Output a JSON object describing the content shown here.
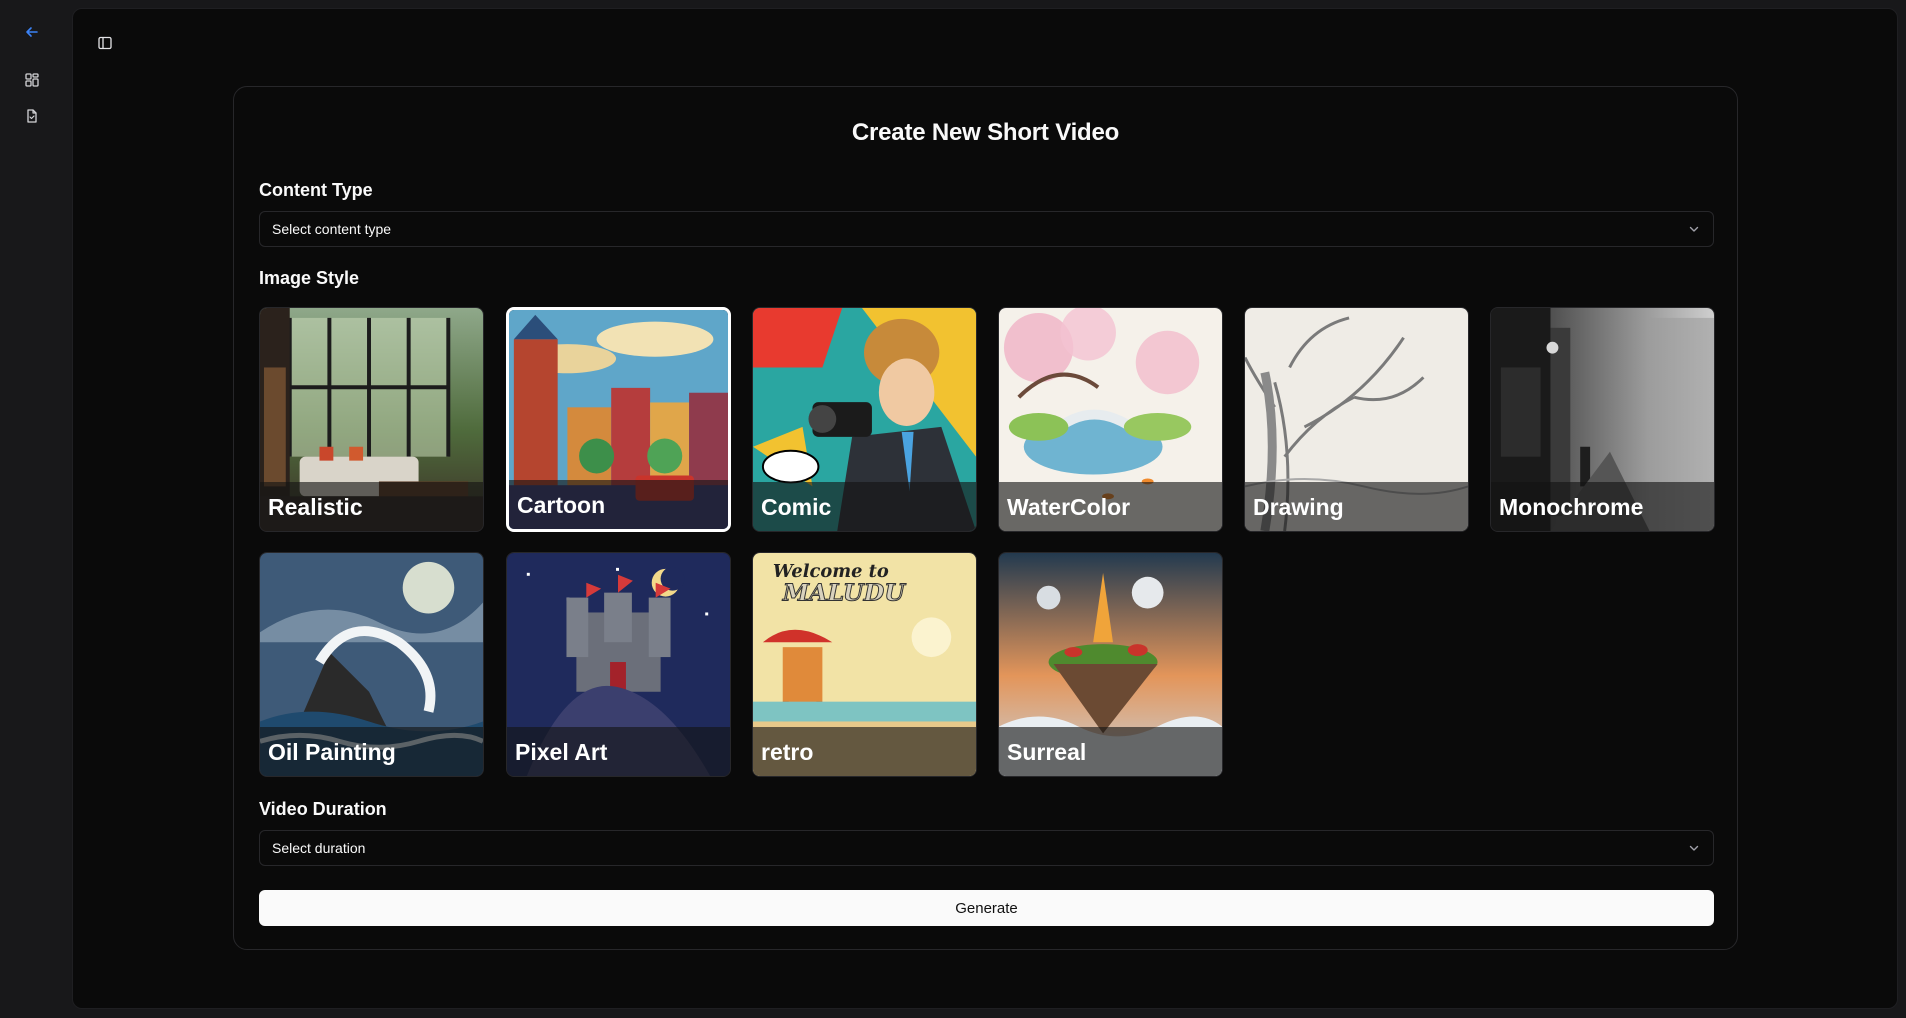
{
  "nav": {
    "back_icon": "arrow-left-icon",
    "dashboard_icon": "dashboard-icon",
    "document_icon": "file-document-icon",
    "toggle_icon": "sidebar-toggle-icon",
    "accent": "#3b82f6"
  },
  "form": {
    "title": "Create New Short Video",
    "content_type": {
      "label": "Content Type",
      "value": "Select content type"
    },
    "image_style": {
      "label": "Image Style",
      "selected": "Cartoon",
      "options": [
        {
          "label": "Realistic"
        },
        {
          "label": "Cartoon"
        },
        {
          "label": "Comic"
        },
        {
          "label": "WaterColor"
        },
        {
          "label": "Drawing"
        },
        {
          "label": "Monochrome"
        },
        {
          "label": "Oil Painting"
        },
        {
          "label": "Pixel Art"
        },
        {
          "label": "retro"
        },
        {
          "label": "Surreal"
        }
      ]
    },
    "duration": {
      "label": "Video Duration",
      "value": "Select duration"
    },
    "generate_label": "Generate"
  }
}
